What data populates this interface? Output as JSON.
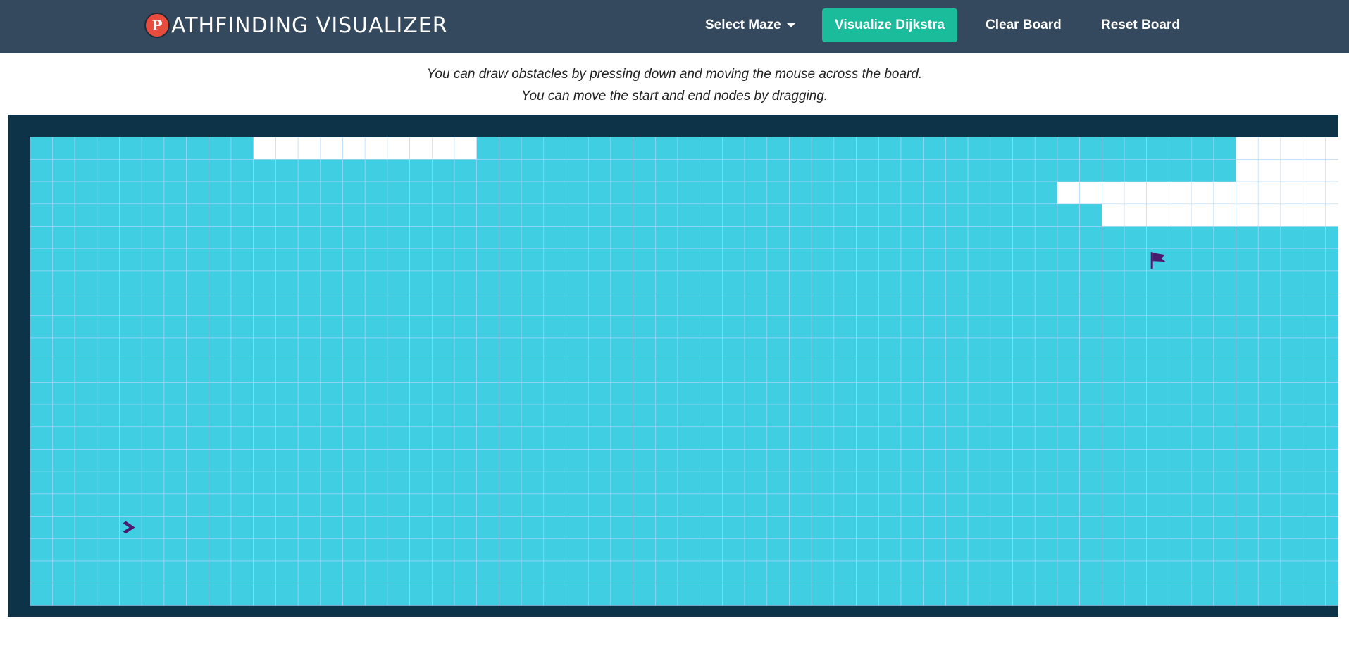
{
  "navbar": {
    "brand_logo_letter": "P",
    "brand_text": "ATHFINDING VISUALIZER",
    "select_maze_label": "Select Maze",
    "visualize_label": "Visualize Dijkstra",
    "clear_label": "Clear Board",
    "reset_label": "Reset Board"
  },
  "instructions": {
    "line1": "You can draw obstacles by pressing down and moving the mouse across the board.",
    "line2": "You can move the start and end nodes by dragging."
  },
  "colors": {
    "wall": "#0d3349",
    "unvisited": "#ffffff",
    "visited": "#40cee3",
    "path": "#fffe6a",
    "grid_line": "#afd8f8",
    "node_icon": "#4b1c6e"
  },
  "grid": {
    "rows": 23,
    "cols": 61,
    "start": {
      "row": 18,
      "col": 5
    },
    "target": {
      "row": 6,
      "col": 51
    },
    "cells": [
      "#############################################################",
      "#..........WWWWWWWWWW..................................WWWWW#",
      "#......................................................WWWWW#",
      "#..............................................WWWWWWWWWWWWW#",
      "#................................................WWWWWWWWWWW#",
      "#............................................................",
      "#............................................................",
      "#............................................................",
      "#............................................................",
      "#............................................................",
      "#............................................................",
      "#............................................................",
      "#............................................................",
      "#............................................................",
      "#............................................................",
      "#............................................................",
      "#............................................................",
      "#............................................................",
      "#............................................................",
      "#............................................................",
      "#............................................................",
      "#............................................................",
      "#############################################################"
    ]
  }
}
